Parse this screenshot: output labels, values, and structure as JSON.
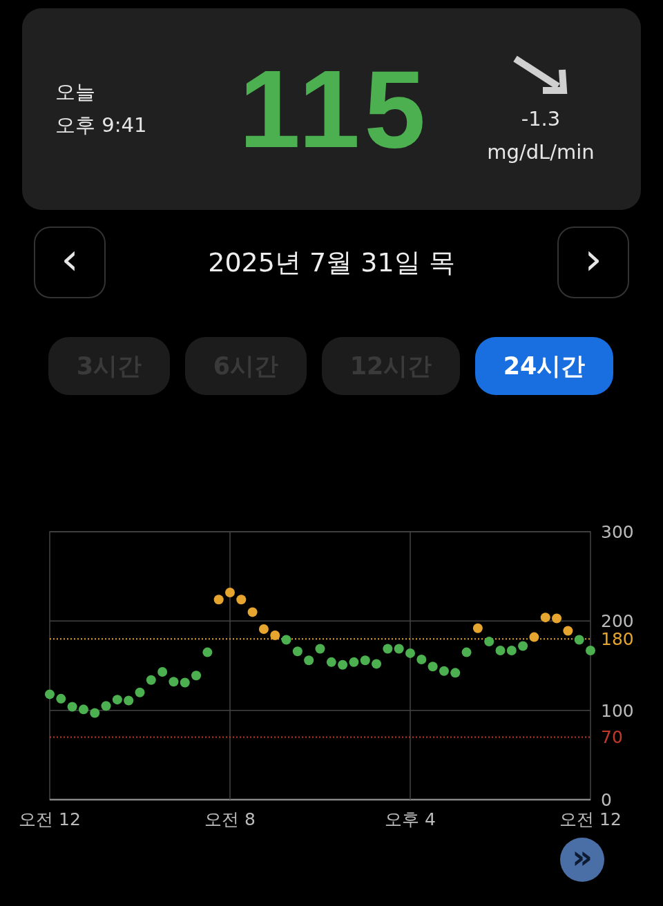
{
  "current": {
    "day": "오늘",
    "time": "오후 9:41",
    "value": "115",
    "trend": "-1.3",
    "unit": "mg/dL/min"
  },
  "date_nav": {
    "prev": "‹",
    "label": "2025년 7월 31일 목",
    "next": "›"
  },
  "ranges": [
    {
      "label": "3시간",
      "selected": false
    },
    {
      "label": "6시간",
      "selected": false
    },
    {
      "label": "12시간",
      "selected": false
    },
    {
      "label": "24시간",
      "selected": true
    }
  ],
  "chart_data": {
    "type": "scatter",
    "ylim": [
      0,
      300
    ],
    "yticks": [
      0,
      100,
      200,
      300
    ],
    "grid": true,
    "ref_lines": [
      {
        "axis": "y",
        "value": 180,
        "label": "180",
        "color": "#e6a52e"
      },
      {
        "axis": "y",
        "value": 70,
        "label": "70",
        "color": "#c0392b"
      }
    ],
    "categories": [
      "오전 12",
      null,
      null,
      null,
      null,
      null,
      null,
      null,
      null,
      null,
      null,
      null,
      null,
      null,
      null,
      null,
      "오전 8",
      null,
      null,
      null,
      null,
      null,
      null,
      null,
      null,
      null,
      null,
      null,
      null,
      null,
      null,
      null,
      "오후 4",
      null,
      null,
      null,
      null,
      null,
      null,
      null,
      null,
      null,
      null,
      null,
      null,
      null,
      null,
      null,
      "오전 12"
    ],
    "series": [
      {
        "color": "#4caf50",
        "values": [
          118,
          113,
          104,
          101,
          97,
          105,
          112,
          111,
          120,
          134,
          143,
          132,
          131,
          139,
          165,
          null,
          null,
          null,
          null,
          null,
          null,
          179,
          166,
          156,
          169,
          154,
          151,
          154,
          156,
          152,
          169,
          169,
          164,
          157,
          149,
          144,
          142,
          165,
          null,
          177,
          167,
          167,
          172,
          null,
          null,
          null,
          null,
          179,
          167
        ]
      },
      {
        "color": "#e6a52e",
        "values": [
          null,
          null,
          null,
          null,
          null,
          null,
          null,
          null,
          null,
          null,
          null,
          null,
          null,
          null,
          null,
          224,
          232,
          224,
          210,
          191,
          184,
          null,
          null,
          null,
          null,
          null,
          null,
          null,
          null,
          null,
          null,
          null,
          null,
          null,
          null,
          null,
          null,
          null,
          192,
          null,
          null,
          null,
          null,
          182,
          204,
          203,
          189,
          null,
          null
        ]
      }
    ]
  },
  "fast_forward": "»"
}
